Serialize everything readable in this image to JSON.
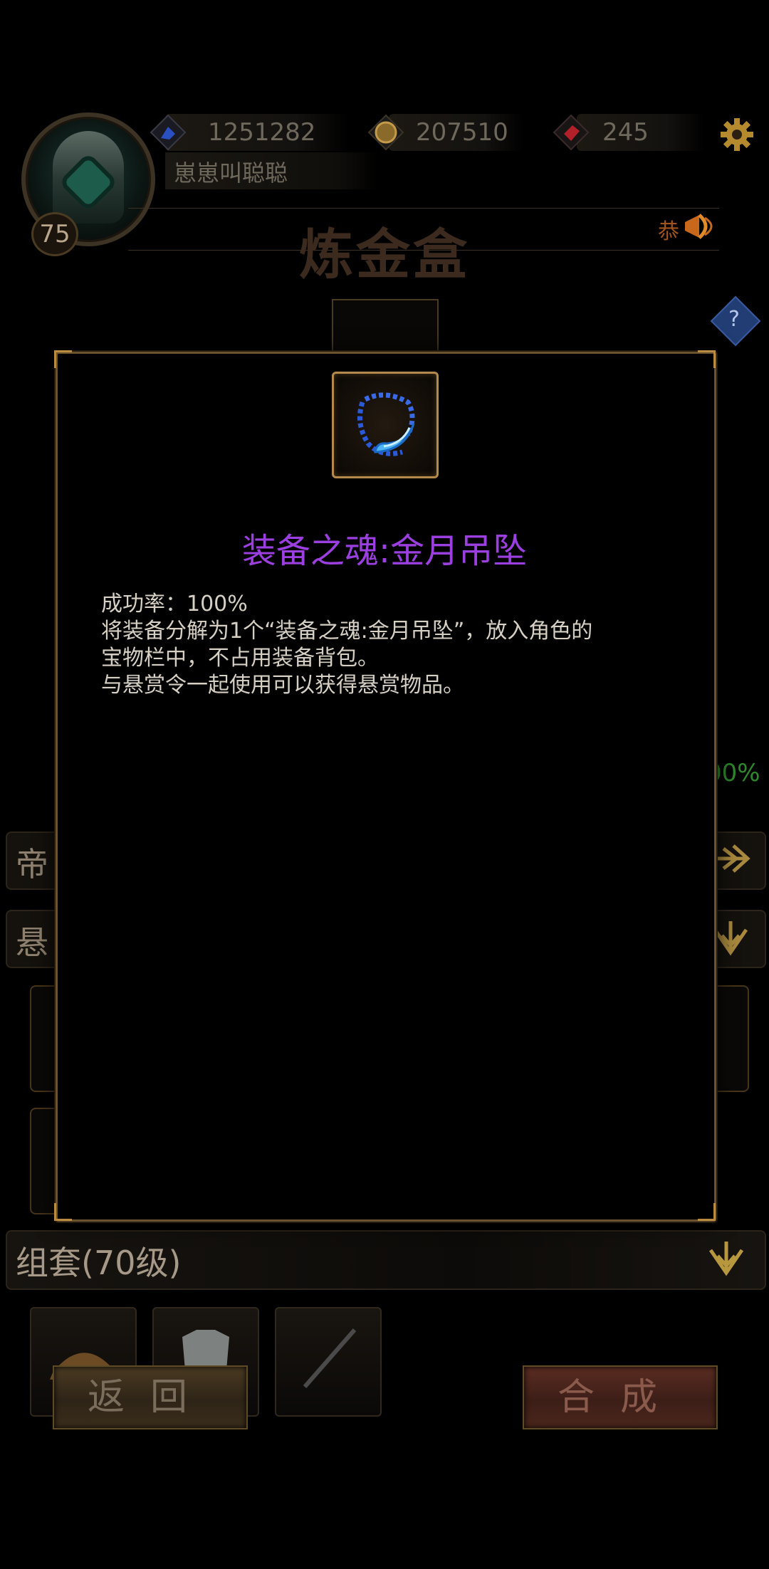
{
  "hud": {
    "level": "75",
    "player_name": "崽崽叫聪聪",
    "resources": [
      {
        "name": "energy",
        "icon": "blue-crystal-icon",
        "value": "1251282"
      },
      {
        "name": "gold",
        "icon": "gold-coin-icon",
        "value": "207510"
      },
      {
        "name": "gems",
        "icon": "red-gem-icon",
        "value": "245"
      }
    ],
    "ticker_text": "恭"
  },
  "page": {
    "title": "炼金盒",
    "help_label": "?"
  },
  "background": {
    "row1_label": "帝",
    "row2_label": "悬",
    "percent_fragment": "00%",
    "set_label": "组套(70级)"
  },
  "buttons": {
    "back": "返回",
    "compose": "合成"
  },
  "modal": {
    "item_icon": "blue-moon-pendant-icon",
    "title": "装备之魂:金月吊坠",
    "description": "成功率：100%\n将装备分解为1个“装备之魂:金月吊坠”，放入角色的\n宝物栏中，不占用装备背包。\n与悬赏令一起使用可以获得悬赏物品。"
  },
  "colors": {
    "title_purple": "#9b3fe0",
    "frame_gold": "#b38a4a",
    "success_green": "#2d8a2a"
  }
}
